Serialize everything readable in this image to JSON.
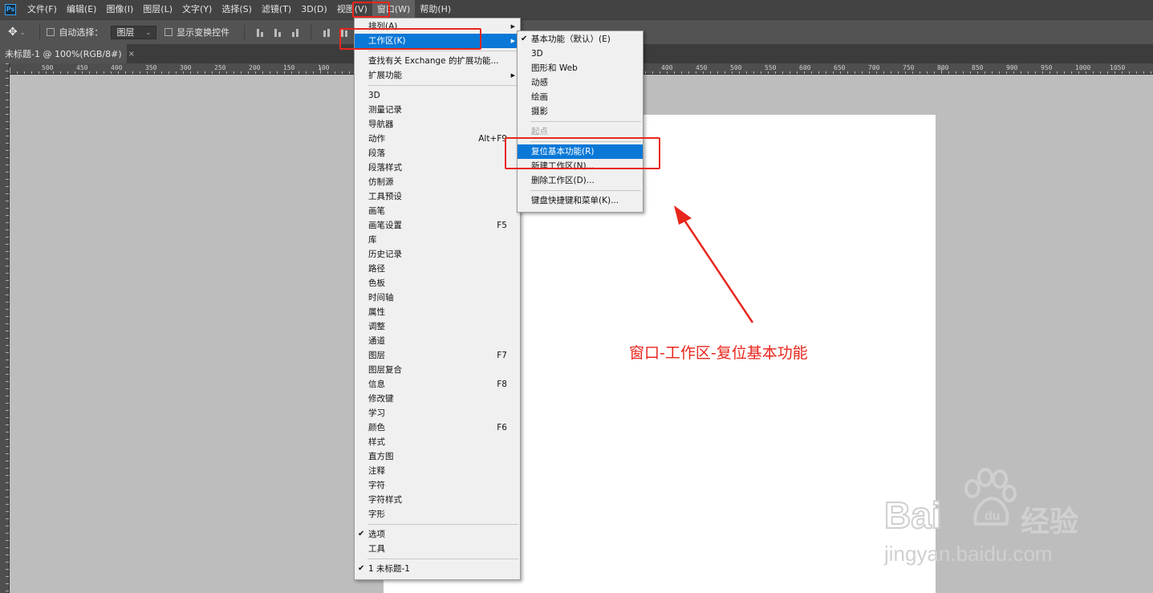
{
  "app": {
    "logo_text": "Ps"
  },
  "menubar": {
    "items": [
      "文件(F)",
      "编辑(E)",
      "图像(I)",
      "图层(L)",
      "文字(Y)",
      "选择(S)",
      "滤镜(T)",
      "3D(D)",
      "视图(V)",
      "窗口(W)",
      "帮助(H)"
    ],
    "active_index": 9
  },
  "options": {
    "auto_select_label": "自动选择：",
    "layer_select_value": "图层",
    "show_transform_label": "显示变换控件"
  },
  "document_tab": {
    "title": "未标题-1 @ 100%(RGB/8#)",
    "close": "×"
  },
  "ruler": {
    "labels_left": [
      "500",
      "450",
      "400",
      "350",
      "300",
      "250",
      "200",
      "150",
      "100"
    ],
    "labels_right": [
      "400",
      "450",
      "500",
      "550",
      "600",
      "650",
      "700",
      "750",
      "800",
      "850",
      "900",
      "950",
      "1000",
      "1050"
    ]
  },
  "window_menu": {
    "items": [
      {
        "label": "排列(A)",
        "arrow": true
      },
      {
        "label": "工作区(K)",
        "arrow": true,
        "highlight": true
      },
      {
        "sep": true
      },
      {
        "label": "查找有关 Exchange 的扩展功能..."
      },
      {
        "label": "扩展功能",
        "arrow": true
      },
      {
        "sep": true
      },
      {
        "label": "3D"
      },
      {
        "label": "测量记录"
      },
      {
        "label": "导航器"
      },
      {
        "label": "动作",
        "shortcut": "Alt+F9"
      },
      {
        "label": "段落"
      },
      {
        "label": "段落样式"
      },
      {
        "label": "仿制源"
      },
      {
        "label": "工具预设"
      },
      {
        "label": "画笔"
      },
      {
        "label": "画笔设置",
        "shortcut": "F5"
      },
      {
        "label": "库"
      },
      {
        "label": "历史记录"
      },
      {
        "label": "路径"
      },
      {
        "label": "色板"
      },
      {
        "label": "时间轴"
      },
      {
        "label": "属性"
      },
      {
        "label": "调整"
      },
      {
        "label": "通道"
      },
      {
        "label": "图层",
        "shortcut": "F7"
      },
      {
        "label": "图层复合"
      },
      {
        "label": "信息",
        "shortcut": "F8"
      },
      {
        "label": "修改键"
      },
      {
        "label": "学习"
      },
      {
        "label": "颜色",
        "shortcut": "F6"
      },
      {
        "label": "样式"
      },
      {
        "label": "直方图"
      },
      {
        "label": "注释"
      },
      {
        "label": "字符"
      },
      {
        "label": "字符样式"
      },
      {
        "label": "字形"
      },
      {
        "sep": true
      },
      {
        "label": "选项",
        "checked": true
      },
      {
        "label": "工具"
      },
      {
        "sep": true
      },
      {
        "label": "1 未标题-1",
        "checked": true
      }
    ]
  },
  "workspace_submenu": {
    "items": [
      {
        "label": "基本功能（默认）(E)",
        "checked": true
      },
      {
        "label": "3D"
      },
      {
        "label": "图形和 Web"
      },
      {
        "label": "动感"
      },
      {
        "label": "绘画"
      },
      {
        "label": "摄影"
      },
      {
        "sep": true
      },
      {
        "label": "起点",
        "disabled": true
      },
      {
        "sep": true
      },
      {
        "label": "复位基本功能(R)",
        "highlight": true
      },
      {
        "label": "新建工作区(N)..."
      },
      {
        "label": "删除工作区(D)..."
      },
      {
        "sep": true
      },
      {
        "label": "键盘快捷键和菜单(K)..."
      }
    ]
  },
  "annotation": {
    "text": "窗口-工作区-复位基本功能"
  },
  "watermark": {
    "brand": "Bai",
    "brand_suffix": "经验",
    "url": "jingyan.baidu.com"
  },
  "colors": {
    "highlight": "#0a78d7",
    "annotation_red": "#e8261c",
    "menubar": "#434343",
    "options_bar": "#535353"
  }
}
